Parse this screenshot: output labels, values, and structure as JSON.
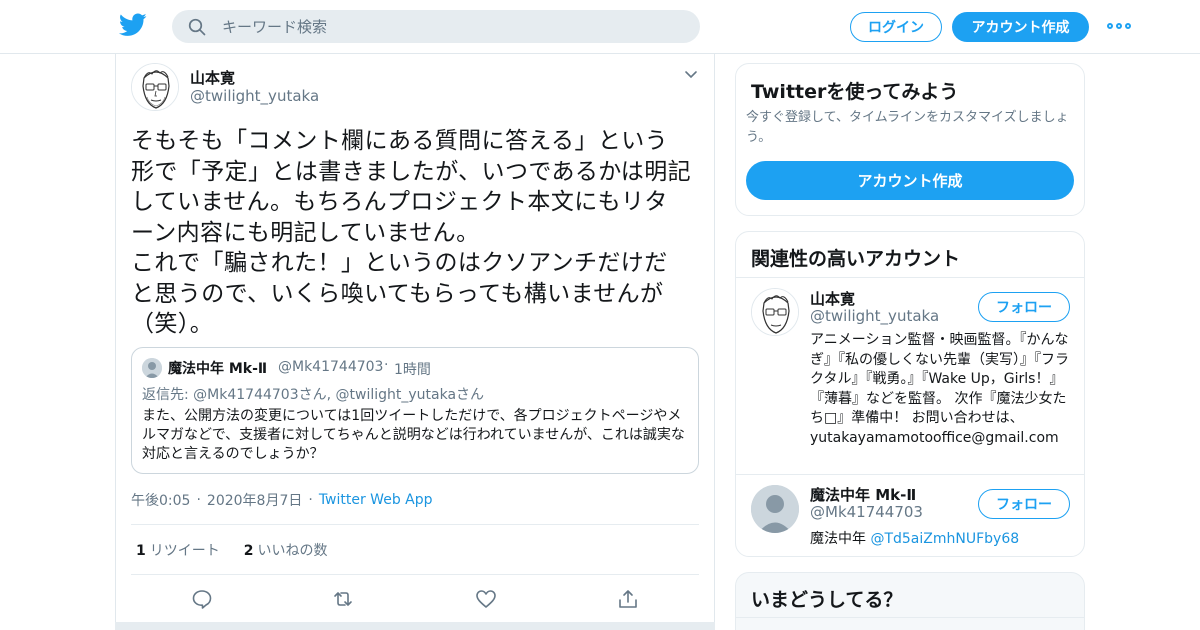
{
  "header": {
    "search_placeholder": "キーワード検索",
    "login_label": "ログイン",
    "signup_label": "アカウント作成"
  },
  "tweet": {
    "author_name": "山本寛",
    "author_handle": "@twilight_yutaka",
    "text": "そもそも「コメント欄にある質問に答える」という\n形で「予定」とは書きましたが、いつであるかは明記\nしていません。もちろんプロジェクト本文にもリタ\nーン内容にも明記していません。\nこれで「騙された！」というのはクソアンチだけだ\nと思うので、いくら喚いてもらっても構いませんが\n（笑）。",
    "quote": {
      "name": "魔法中年 Mk-Ⅱ",
      "handle": "@Mk41744703",
      "dot": "·",
      "time": "1時間",
      "reply_to": "返信先: @Mk41744703さん, @twilight_yutakaさん",
      "text": "また、公開方法の変更については1回ツイートしただけで、各プロジェクトページやメルマガなどで、支援者に対してちゃんと説明などは行われていませんが、これは誠実な対応と言えるのでしょうか？"
    },
    "time": "午後0:05",
    "dot1": "·",
    "date": "2020年8月7日",
    "dot2": "·",
    "app": "Twitter Web App",
    "retweets_count": "1",
    "retweets_label": "リツイート",
    "likes_count": "2",
    "likes_label": "いいねの数"
  },
  "sidebar": {
    "try_card": {
      "title": "Twitterを使ってみよう",
      "subtitle": "今すぐ登録して、タイムラインをカスタマイズしましょう。",
      "button_label": "アカウント作成"
    },
    "related": {
      "title": "関連性の高いアカウント",
      "accounts": [
        {
          "name": "山本寛",
          "handle": "@twilight_yutaka",
          "follow_label": "フォロー",
          "bio": "アニメーション監督・映画監督。『かんなぎ』『私の優しくない先輩（実写）』『フラクタル』『戦勇。』『Wake Up，Girls！』『薄暮』などを監督。 次作『魔法少女たち□』準備中！ お問い合わせは、yutakayamamotooffice@gmail.com"
        },
        {
          "name": "魔法中年 Mk-Ⅱ",
          "handle": "@Mk41744703",
          "follow_label": "フォロー",
          "bio_prefix": "魔法中年 ",
          "bio_link": "@Td5aiZmhNUFby68"
        }
      ]
    },
    "trends": {
      "title": "いまどうしてる？"
    }
  },
  "colors": {
    "accent": "#1da1f2",
    "link": "#1b95e0",
    "secondary_text": "#657786",
    "border": "#e6ecf0"
  }
}
